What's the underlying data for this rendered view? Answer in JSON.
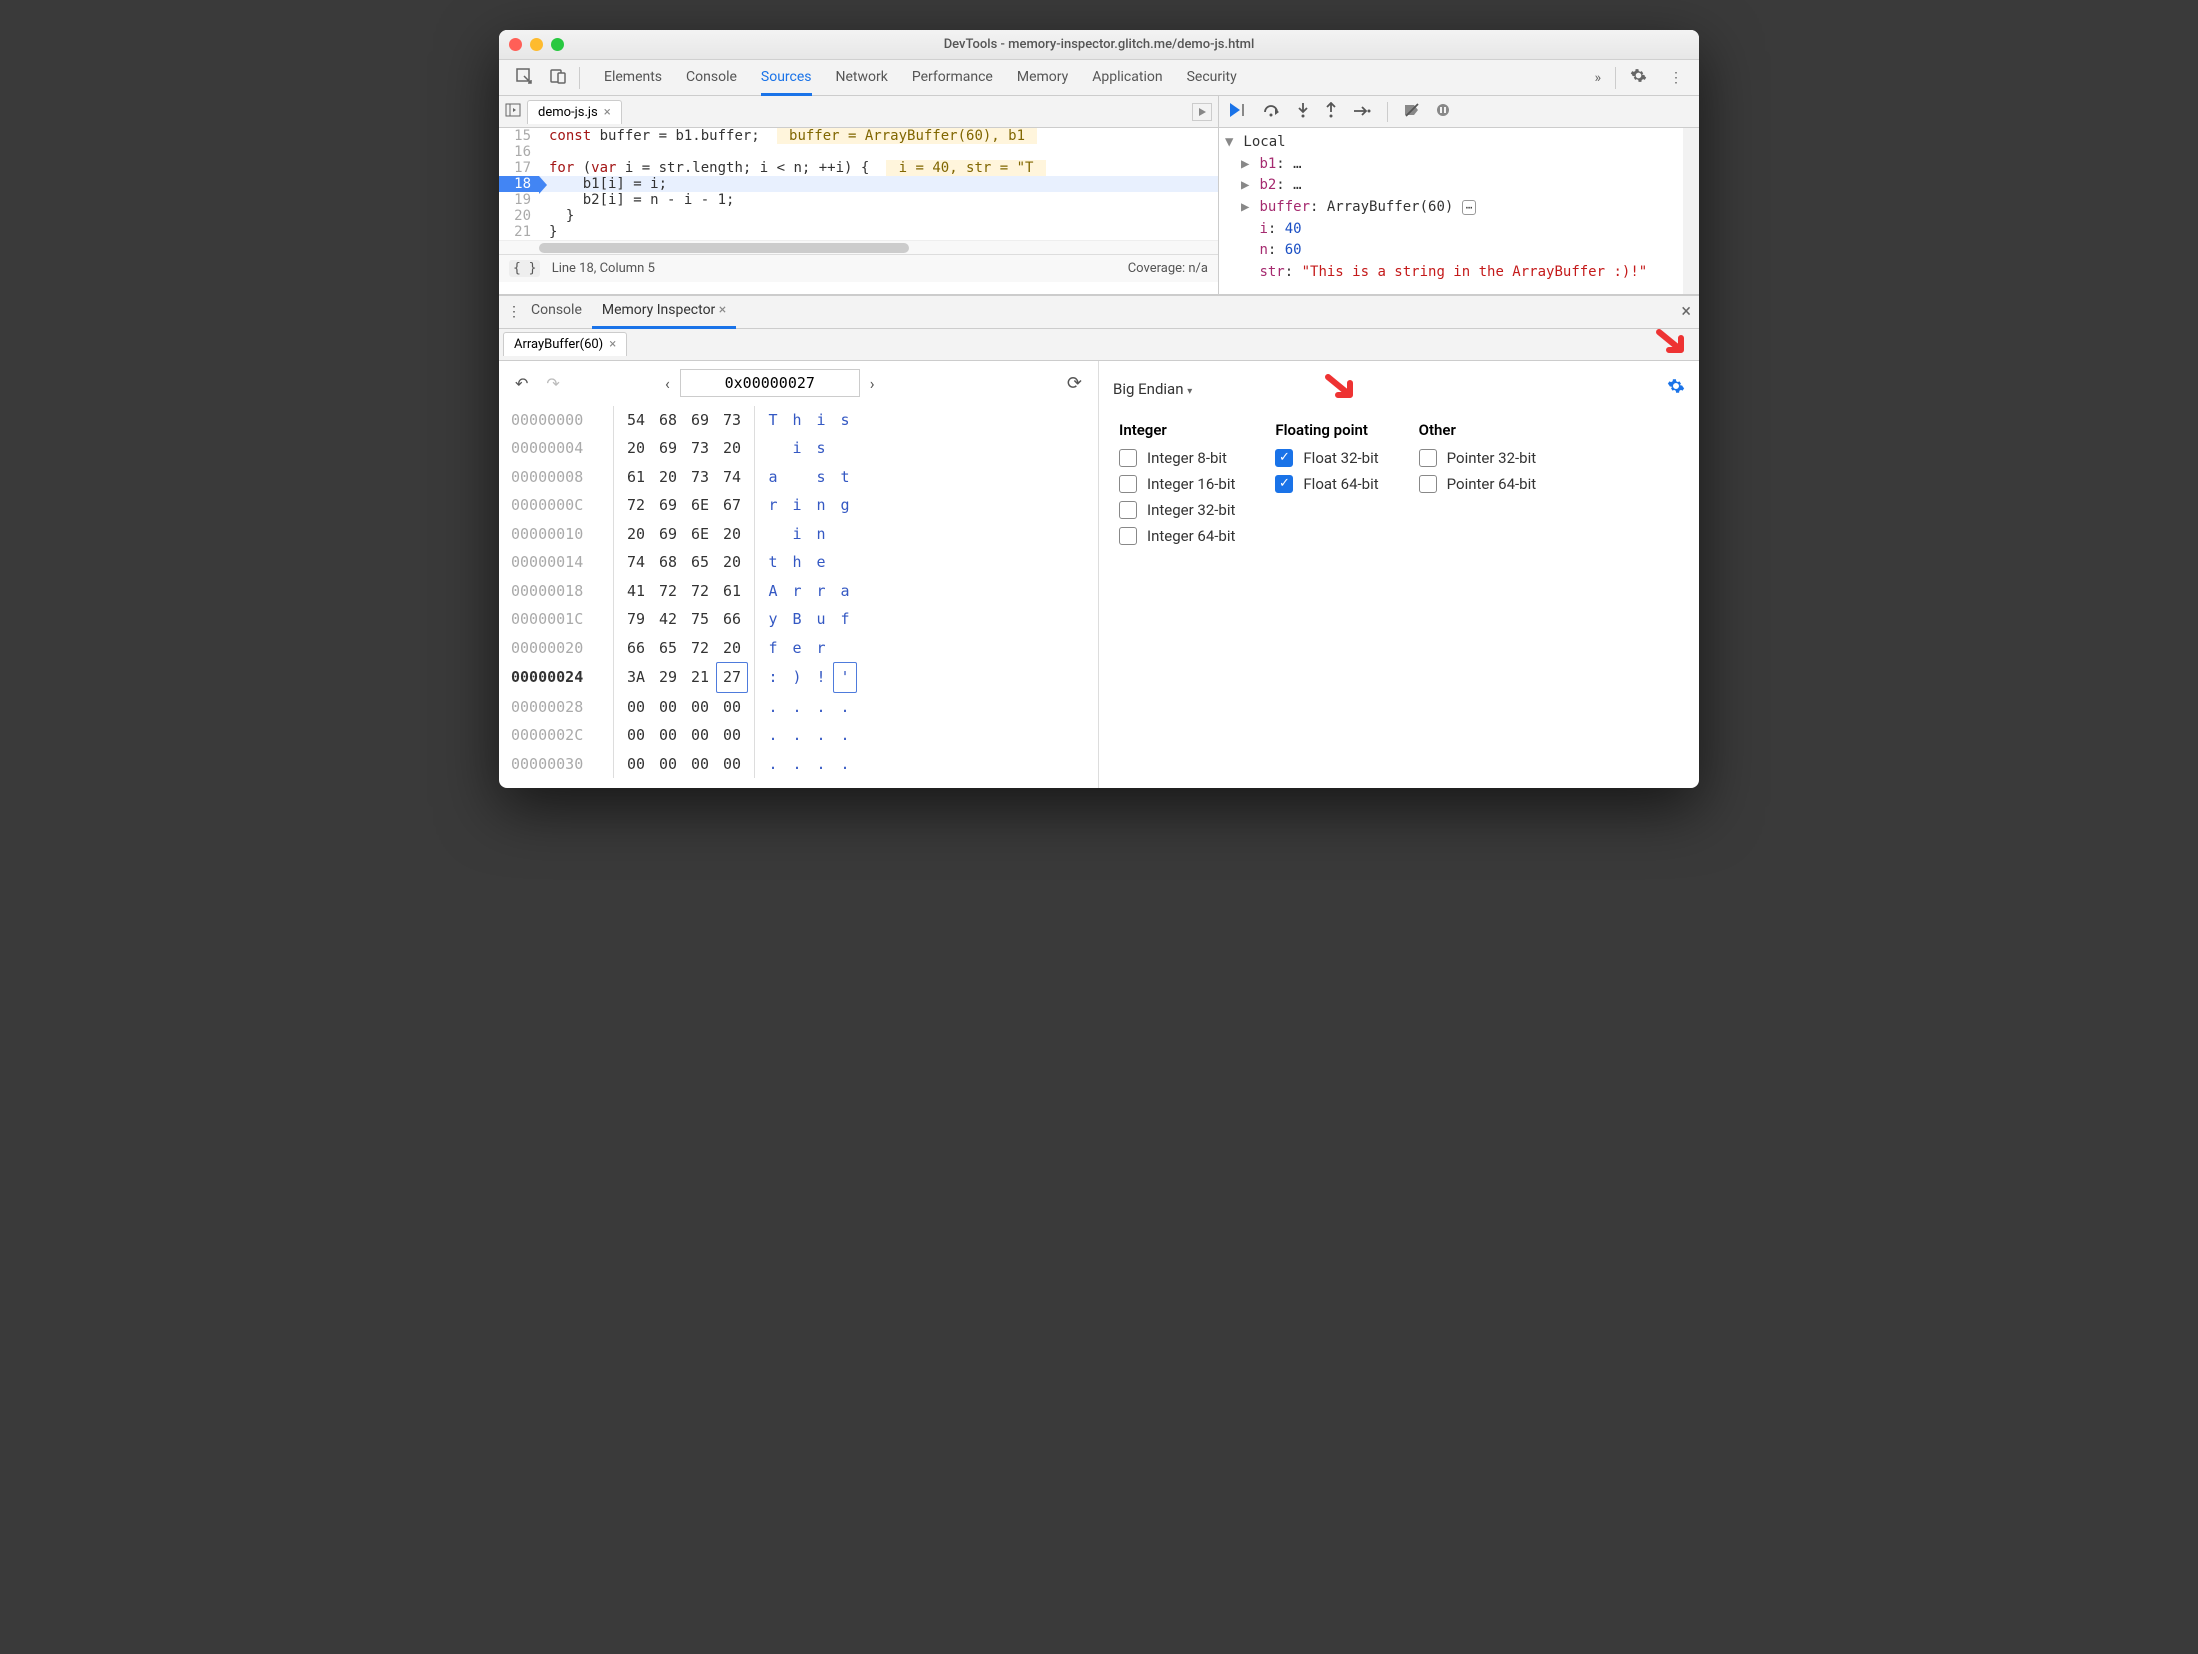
{
  "window": {
    "title": "DevTools - memory-inspector.glitch.me/demo-js.html"
  },
  "toolbar": {
    "tabs": [
      "Elements",
      "Console",
      "Sources",
      "Network",
      "Performance",
      "Memory",
      "Application",
      "Security"
    ],
    "activeTab": "Sources",
    "moreGlyph": "»"
  },
  "file": {
    "name": "demo-js.js",
    "close": "×"
  },
  "code": {
    "lines": [
      {
        "n": 15,
        "text": "const buffer = b1.buffer;",
        "hint": "buffer = ArrayBuffer(60), b1"
      },
      {
        "n": 16,
        "text": ""
      },
      {
        "n": 17,
        "text": "for (var i = str.length; i < n; ++i) {",
        "hint": "i = 40, str = \"T"
      },
      {
        "n": 18,
        "text": "    b1[i] = i;",
        "active": true
      },
      {
        "n": 19,
        "text": "    b2[i] = n - i - 1;"
      },
      {
        "n": 20,
        "text": "  }"
      },
      {
        "n": 21,
        "text": "}"
      }
    ],
    "status_left_symbol": "{ }",
    "status_left": "Line 18, Column 5",
    "status_right": "Coverage: n/a"
  },
  "scope": {
    "header": "Local",
    "rows": [
      {
        "k": "b1",
        "v": "…",
        "arrow": true
      },
      {
        "k": "b2",
        "v": "…",
        "arrow": true
      },
      {
        "k": "buffer",
        "v": "ArrayBuffer(60)",
        "arrow": true,
        "icon": true
      },
      {
        "k": "i",
        "v": "40",
        "num": true
      },
      {
        "k": "n",
        "v": "60",
        "num": true
      },
      {
        "k": "str",
        "v": "\"This is a string in the ArrayBuffer :)!\"",
        "str": true
      }
    ]
  },
  "drawer": {
    "tabs": [
      "Console",
      "Memory Inspector"
    ],
    "activeTab": "Memory Inspector",
    "subtab": "ArrayBuffer(60)",
    "close": "×"
  },
  "mi": {
    "address": "0x00000027",
    "rows": [
      {
        "addr": "00000000",
        "hex": [
          "54",
          "68",
          "69",
          "73"
        ],
        "ascii": [
          "T",
          "h",
          "i",
          "s"
        ]
      },
      {
        "addr": "00000004",
        "hex": [
          "20",
          "69",
          "73",
          "20"
        ],
        "ascii": [
          " ",
          "i",
          "s",
          " "
        ]
      },
      {
        "addr": "00000008",
        "hex": [
          "61",
          "20",
          "73",
          "74"
        ],
        "ascii": [
          "a",
          " ",
          "s",
          "t"
        ]
      },
      {
        "addr": "0000000C",
        "hex": [
          "72",
          "69",
          "6E",
          "67"
        ],
        "ascii": [
          "r",
          "i",
          "n",
          "g"
        ]
      },
      {
        "addr": "00000010",
        "hex": [
          "20",
          "69",
          "6E",
          "20"
        ],
        "ascii": [
          " ",
          "i",
          "n",
          " "
        ]
      },
      {
        "addr": "00000014",
        "hex": [
          "74",
          "68",
          "65",
          "20"
        ],
        "ascii": [
          "t",
          "h",
          "e",
          " "
        ]
      },
      {
        "addr": "00000018",
        "hex": [
          "41",
          "72",
          "72",
          "61"
        ],
        "ascii": [
          "A",
          "r",
          "r",
          "a"
        ]
      },
      {
        "addr": "0000001C",
        "hex": [
          "79",
          "42",
          "75",
          "66"
        ],
        "ascii": [
          "y",
          "B",
          "u",
          "f"
        ]
      },
      {
        "addr": "00000020",
        "hex": [
          "66",
          "65",
          "72",
          "20"
        ],
        "ascii": [
          "f",
          "e",
          "r",
          " "
        ]
      },
      {
        "addr": "00000024",
        "hex": [
          "3A",
          "29",
          "21",
          "27"
        ],
        "ascii": [
          ":",
          ")",
          "!",
          "'"
        ],
        "bold": true,
        "hiHex": 3,
        "hiAscii": 3
      },
      {
        "addr": "00000028",
        "hex": [
          "00",
          "00",
          "00",
          "00"
        ],
        "ascii": [
          ".",
          ".",
          ".",
          "."
        ]
      },
      {
        "addr": "0000002C",
        "hex": [
          "00",
          "00",
          "00",
          "00"
        ],
        "ascii": [
          ".",
          ".",
          ".",
          "."
        ]
      },
      {
        "addr": "00000030",
        "hex": [
          "00",
          "00",
          "00",
          "00"
        ],
        "ascii": [
          ".",
          ".",
          ".",
          "."
        ]
      }
    ]
  },
  "settings": {
    "endian": "Big Endian",
    "groups": {
      "integer": {
        "title": "Integer",
        "items": [
          {
            "label": "Integer 8-bit",
            "checked": false
          },
          {
            "label": "Integer 16-bit",
            "checked": false
          },
          {
            "label": "Integer 32-bit",
            "checked": false
          },
          {
            "label": "Integer 64-bit",
            "checked": false
          }
        ]
      },
      "float": {
        "title": "Floating point",
        "items": [
          {
            "label": "Float 32-bit",
            "checked": true
          },
          {
            "label": "Float 64-bit",
            "checked": true
          }
        ]
      },
      "other": {
        "title": "Other",
        "items": [
          {
            "label": "Pointer 32-bit",
            "checked": false
          },
          {
            "label": "Pointer 64-bit",
            "checked": false
          }
        ]
      }
    }
  }
}
